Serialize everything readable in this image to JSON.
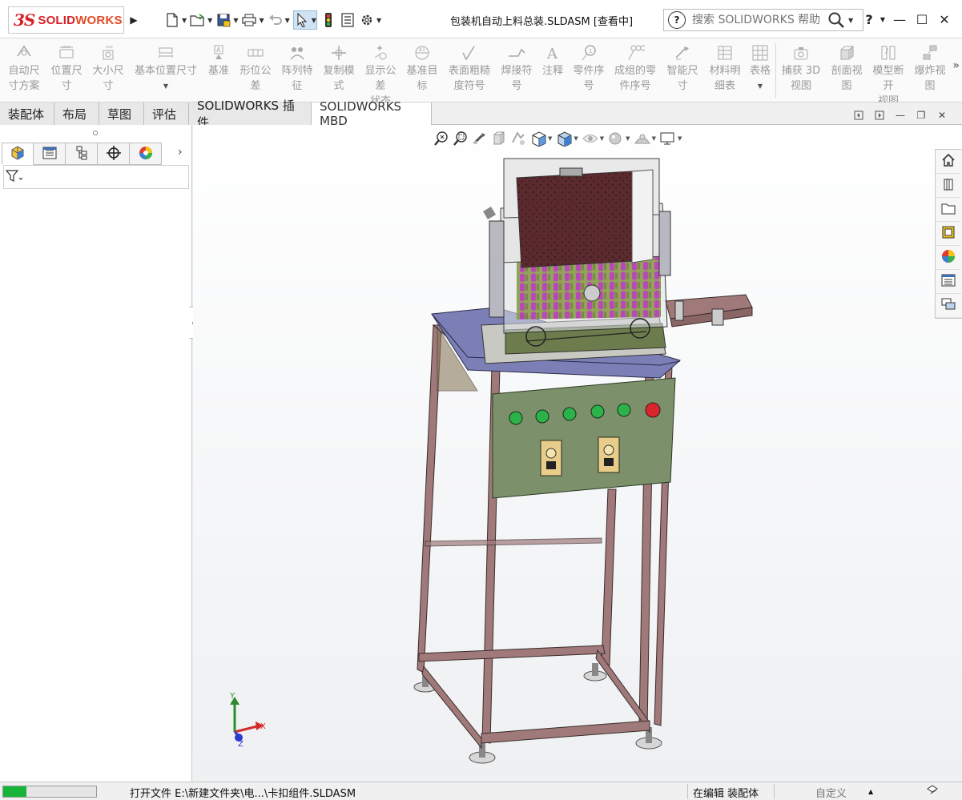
{
  "app": {
    "logo": {
      "mark": "3S",
      "brand_solid": "SOLID",
      "brand_works": "WORKS"
    },
    "window_title": "包装机自动上料总装.SLDASM [查看中]"
  },
  "search": {
    "placeholder": "搜索 SOLIDWORKS 帮助"
  },
  "help_label": "?",
  "ribbon": {
    "items": [
      {
        "label": "自动尺寸方案",
        "icon": "auto-dimension-icon"
      },
      {
        "label": "位置尺寸",
        "icon": "location-dimension-icon"
      },
      {
        "label": "大小尺寸",
        "icon": "size-dimension-icon"
      },
      {
        "label": "基本位置尺寸",
        "icon": "basic-location-dimension-icon"
      },
      {
        "label": "基准",
        "icon": "datum-icon"
      },
      {
        "label": "形位公差",
        "icon": "geometric-tolerance-icon"
      },
      {
        "label": "阵列特征",
        "icon": "pattern-feature-icon"
      },
      {
        "label": "复制模式",
        "icon": "copy-scheme-icon"
      },
      {
        "label": "显示公差状态",
        "icon": "show-tolerance-status-icon"
      },
      {
        "label": "基准目标",
        "icon": "datum-target-icon"
      },
      {
        "label": "表面粗糙度符号",
        "icon": "surface-finish-icon"
      },
      {
        "label": "焊接符号",
        "icon": "weld-symbol-icon"
      },
      {
        "label": "注释",
        "icon": "note-icon"
      },
      {
        "label": "零件序号",
        "icon": "balloon-icon"
      },
      {
        "label": "成组的零件序号",
        "icon": "stacked-balloon-icon"
      },
      {
        "label": "智能尺寸",
        "icon": "smart-dimension-icon"
      },
      {
        "label": "材料明细表",
        "icon": "bom-icon"
      },
      {
        "label": "表格",
        "icon": "table-icon"
      },
      {
        "label": "捕获 3D 视图",
        "icon": "capture-3d-view-icon"
      },
      {
        "label": "剖面视图",
        "icon": "section-view-icon"
      },
      {
        "label": "模型断开视图",
        "icon": "model-break-view-icon"
      },
      {
        "label": "爆炸视图",
        "icon": "exploded-view-icon"
      }
    ]
  },
  "tabs": [
    {
      "label": "装配体"
    },
    {
      "label": "布局"
    },
    {
      "label": "草图"
    },
    {
      "label": "评估"
    },
    {
      "label": "SOLIDWORKS 插件"
    },
    {
      "label": "SOLIDWORKS MBD",
      "active": true
    }
  ],
  "triad": {
    "x": "X",
    "y": "Y",
    "z": "Z"
  },
  "statusbar": {
    "progress": 0.25,
    "message": "打开文件  E:\\新建文件夹\\电...\\卡扣组件.SLDASM",
    "mode": "在编辑 装配体",
    "custom": "自定义"
  },
  "colors": {
    "accent": "#d72027",
    "frame": "#a07a7a",
    "panel": "#7c916b",
    "top_plate": "#7b7fb5",
    "progress": "#18b43a"
  }
}
